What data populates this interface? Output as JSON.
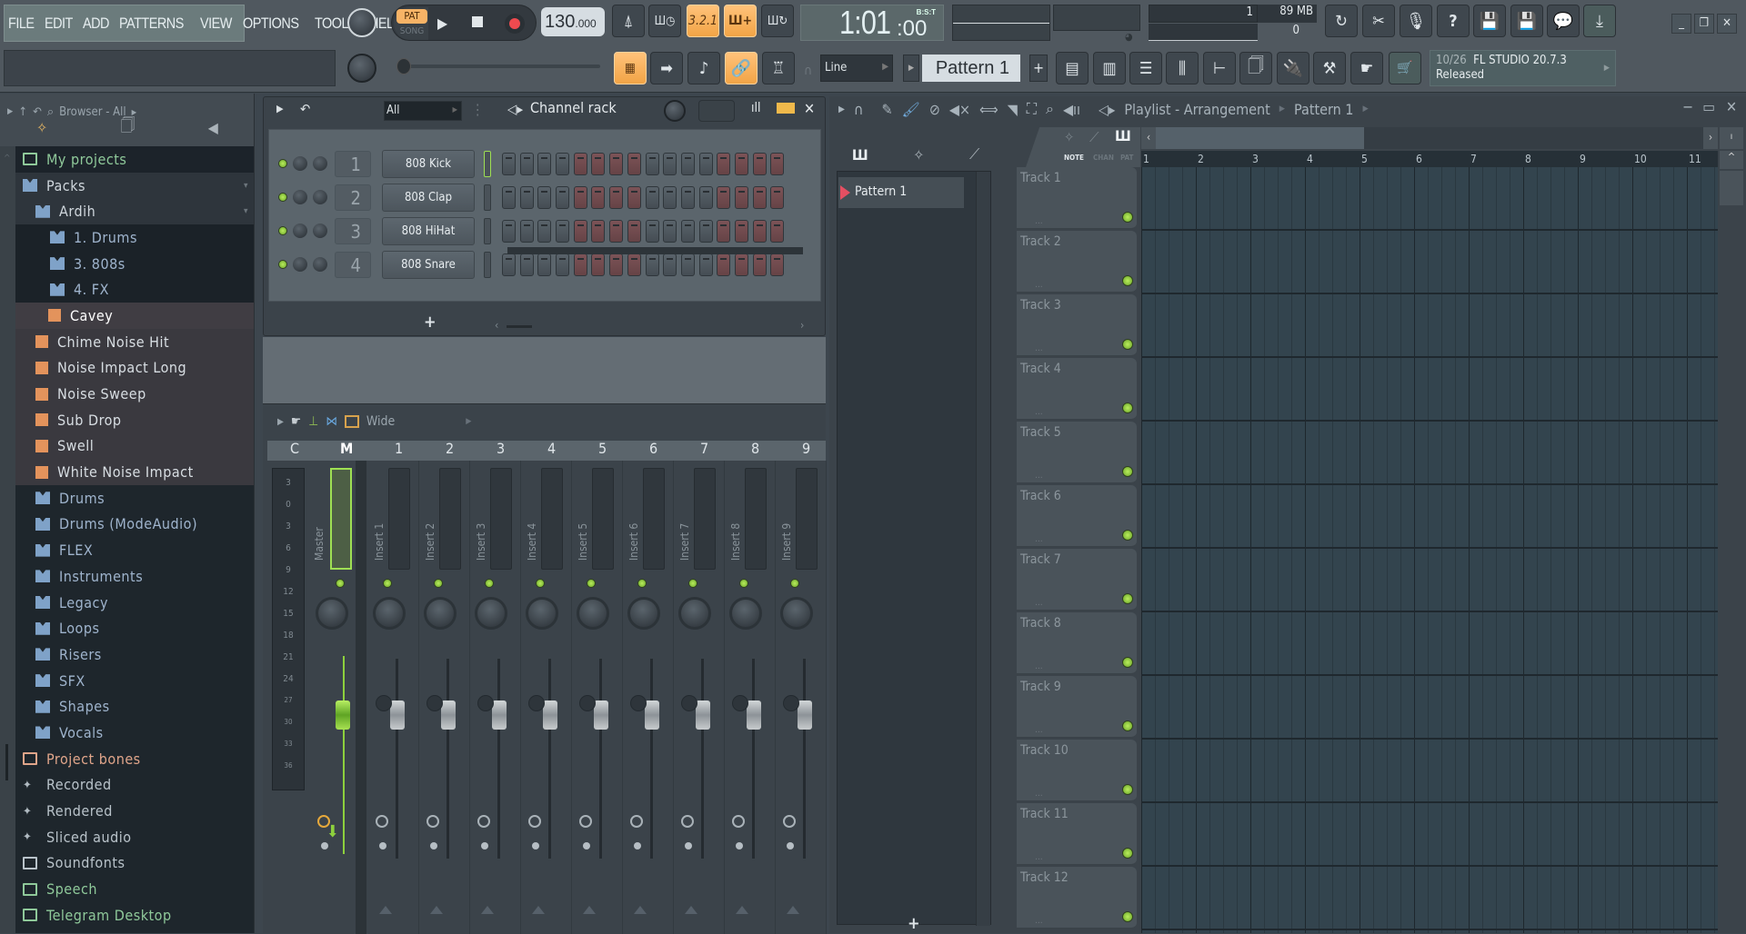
{
  "menu": [
    "FILE",
    "EDIT",
    "ADD",
    "PATTERNS",
    "VIEW",
    "OPTIONS",
    "TOOLS",
    "HELP"
  ],
  "transport": {
    "pat_label": "PAT",
    "song_label": "SONG",
    "mode": "PAT",
    "tempo_int": "130",
    "tempo_dec": ".000"
  },
  "time": {
    "value": "1:01",
    "ticks": ":00",
    "format": "B:S:T"
  },
  "cpu": {
    "voices": "1",
    "memory": "89 MB",
    "polyphony": "0"
  },
  "snap": {
    "label": "Line"
  },
  "pattern": {
    "name": "Pattern 1",
    "add": "+"
  },
  "hint": {
    "count": "10/26",
    "title": "FL STUDIO 20.7.3",
    "status": "Released"
  },
  "window_controls": {
    "minimize": "_",
    "restore": "❐",
    "close": "✕"
  },
  "browser": {
    "title": "Browser - All",
    "items": [
      {
        "label": "My projects",
        "type": "folder-special",
        "color": "#8fc99a",
        "level": 0
      },
      {
        "label": "Packs",
        "type": "pack",
        "color": "#cfd6dc",
        "level": 0
      },
      {
        "label": "Ardih",
        "type": "pack",
        "color": "#cfd6dc",
        "level": 1
      },
      {
        "label": "1. Drums",
        "type": "pack",
        "color": "#9fb4cd",
        "level": 2
      },
      {
        "label": "3. 808s",
        "type": "pack",
        "color": "#9fb4cd",
        "level": 2
      },
      {
        "label": "4. FX",
        "type": "pack",
        "color": "#9fb4cd",
        "level": 2
      },
      {
        "label": "Cavey",
        "type": "sample",
        "color": "#ffffff",
        "level": 3,
        "selected": true
      },
      {
        "label": "Chime Noise Hit",
        "type": "sample",
        "color": "#d8dee3",
        "level": 2
      },
      {
        "label": "Noise Impact Long",
        "type": "sample",
        "color": "#d8dee3",
        "level": 2
      },
      {
        "label": "Noise Sweep",
        "type": "sample",
        "color": "#d8dee3",
        "level": 2
      },
      {
        "label": "Sub Drop",
        "type": "sample",
        "color": "#d8dee3",
        "level": 2
      },
      {
        "label": "Swell",
        "type": "sample",
        "color": "#d8dee3",
        "level": 2
      },
      {
        "label": "White Noise Impact",
        "type": "sample",
        "color": "#d8dee3",
        "level": 2
      },
      {
        "label": "Drums",
        "type": "pack",
        "color": "#9fb4cd",
        "level": 1
      },
      {
        "label": "Drums (ModeAudio)",
        "type": "pack",
        "color": "#9fb4cd",
        "level": 1
      },
      {
        "label": "FLEX",
        "type": "pack",
        "color": "#9fb4cd",
        "level": 1
      },
      {
        "label": "Instruments",
        "type": "pack",
        "color": "#9fb4cd",
        "level": 1
      },
      {
        "label": "Legacy",
        "type": "pack",
        "color": "#9fb4cd",
        "level": 1
      },
      {
        "label": "Loops",
        "type": "pack",
        "color": "#9fb4cd",
        "level": 1
      },
      {
        "label": "Risers",
        "type": "pack",
        "color": "#9fb4cd",
        "level": 1
      },
      {
        "label": "SFX",
        "type": "pack",
        "color": "#9fb4cd",
        "level": 1
      },
      {
        "label": "Shapes",
        "type": "pack",
        "color": "#9fb4cd",
        "level": 1
      },
      {
        "label": "Vocals",
        "type": "pack",
        "color": "#9fb4cd",
        "level": 1
      },
      {
        "label": "Project bones",
        "type": "folder-special",
        "color": "#e0a58a",
        "level": 0
      },
      {
        "label": "Recorded",
        "type": "audio",
        "color": "#b9c3ca",
        "level": 0
      },
      {
        "label": "Rendered",
        "type": "audio",
        "color": "#b9c3ca",
        "level": 0
      },
      {
        "label": "Sliced audio",
        "type": "audio",
        "color": "#b9c3ca",
        "level": 0
      },
      {
        "label": "Soundfonts",
        "type": "folder",
        "color": "#b9c3ca",
        "level": 0
      },
      {
        "label": "Speech",
        "type": "folder-special",
        "color": "#8fc99a",
        "level": 0
      },
      {
        "label": "Telegram Desktop",
        "type": "folder-special",
        "color": "#8fc99a",
        "level": 0
      }
    ]
  },
  "channel_rack": {
    "title": "Channel rack",
    "filter": "All",
    "add": "+",
    "channels": [
      {
        "num": "1",
        "name": "808 Kick",
        "selected": true
      },
      {
        "num": "2",
        "name": "808 Clap",
        "selected": false
      },
      {
        "num": "3",
        "name": "808 HiHat",
        "selected": false
      },
      {
        "num": "4",
        "name": "808 Snare",
        "selected": false
      }
    ],
    "steps_per_channel": 16
  },
  "mixer": {
    "preset": "Wide",
    "columns": [
      "C",
      "M",
      "1",
      "2",
      "3",
      "4",
      "5",
      "6",
      "7",
      "8",
      "9"
    ],
    "scale": [
      "3",
      "0",
      "3",
      "6",
      "9",
      "12",
      "15",
      "18",
      "21",
      "24",
      "27",
      "30",
      "33",
      "36"
    ],
    "master_label": "Master",
    "inserts": [
      "Insert 1",
      "Insert 2",
      "Insert 3",
      "Insert 4",
      "Insert 5",
      "Insert 6",
      "Insert 7",
      "Insert 8",
      "Insert 9"
    ]
  },
  "playlist": {
    "title": "Playlist - Arrangement",
    "pattern": "Pattern 1",
    "picker_pattern": "Pattern 1",
    "view_tabs": [
      "NOTE",
      "CHAN",
      "PAT"
    ],
    "ruler": [
      "1",
      "2",
      "3",
      "4",
      "5",
      "6",
      "7",
      "8",
      "9",
      "10",
      "11"
    ],
    "tracks": [
      "Track 1",
      "Track 2",
      "Track 3",
      "Track 4",
      "Track 5",
      "Track 6",
      "Track 7",
      "Track 8",
      "Track 9",
      "Track 10",
      "Track 11",
      "Track 12"
    ],
    "add": "+"
  }
}
